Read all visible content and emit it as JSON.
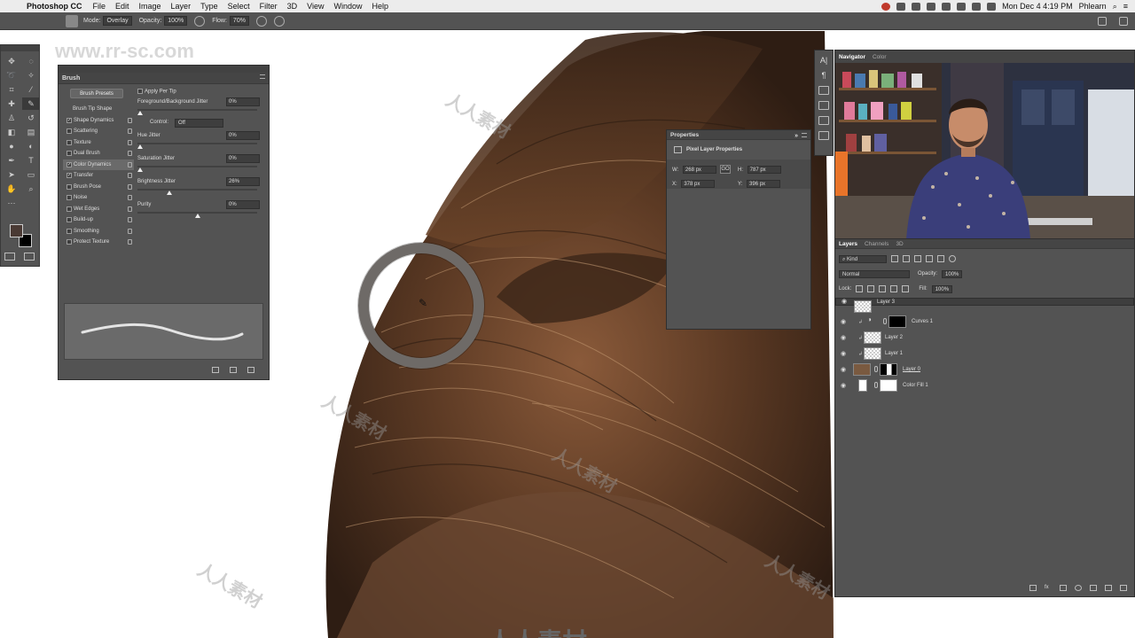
{
  "menubar": {
    "app_name": "Photoshop CC",
    "items": [
      "File",
      "Edit",
      "Image",
      "Layer",
      "Type",
      "Select",
      "Filter",
      "3D",
      "View",
      "Window",
      "Help"
    ],
    "clock": "Mon Dec 4  4:19 PM",
    "user": "Phlearn"
  },
  "options": {
    "mode_label": "Mode:",
    "mode_value": "Overlay",
    "opacity_label": "Opacity:",
    "opacity_value": "100%",
    "flow_label": "Flow:",
    "flow_value": "70%"
  },
  "watermark": {
    "url": "www.rr-sc.com",
    "text": "人人素材"
  },
  "brush_panel": {
    "title": "Brush",
    "presets_button": "Brush Presets",
    "tip_shape": "Brush Tip Shape",
    "items": [
      {
        "label": "Shape Dynamics",
        "checked": true
      },
      {
        "label": "Scattering",
        "checked": false
      },
      {
        "label": "Texture",
        "checked": false
      },
      {
        "label": "Dual Brush",
        "checked": false
      },
      {
        "label": "Color Dynamics",
        "checked": true
      },
      {
        "label": "Transfer",
        "checked": true
      },
      {
        "label": "Brush Pose",
        "checked": false
      },
      {
        "label": "Noise",
        "checked": false
      },
      {
        "label": "Wet Edges",
        "checked": false
      },
      {
        "label": "Build-up",
        "checked": false
      },
      {
        "label": "Smoothing",
        "checked": false
      },
      {
        "label": "Protect Texture",
        "checked": false
      }
    ],
    "apply_per_tip": "Apply Per Tip",
    "fg_bg_jitter_label": "Foreground/Background Jitter",
    "fg_bg_jitter_value": "0%",
    "control_label": "Control:",
    "control_value": "Off",
    "hue_jitter_label": "Hue Jitter",
    "hue_jitter_value": "0%",
    "saturation_jitter_label": "Saturation Jitter",
    "saturation_jitter_value": "0%",
    "brightness_jitter_label": "Brightness Jitter",
    "brightness_jitter_value": "26%",
    "purity_label": "Purity",
    "purity_value": "0%"
  },
  "properties": {
    "title": "Properties",
    "subtitle": "Pixel Layer Properties",
    "w_label": "W:",
    "w_value": "268 px",
    "h_label": "H:",
    "h_value": "787 px",
    "x_label": "X:",
    "x_value": "378 px",
    "y_label": "Y:",
    "y_value": "396 px",
    "link_glyph": "GO"
  },
  "navigator": {
    "tabs": [
      "Navigator",
      "Color"
    ]
  },
  "layers": {
    "tabs": [
      "Layers",
      "Channels",
      "3D"
    ],
    "kind_label": "Kind",
    "blend_mode": "Normal",
    "opacity_label": "Opacity:",
    "opacity_value": "100%",
    "lock_label": "Lock:",
    "fill_label": "Fill:",
    "fill_value": "100%",
    "rows": [
      {
        "name": "Layer 3",
        "selected": true
      },
      {
        "name": "Curves 1",
        "selected": false
      },
      {
        "name": "Layer 2",
        "selected": false
      },
      {
        "name": "Layer 1",
        "selected": false
      },
      {
        "name": "Layer 0",
        "selected": false
      },
      {
        "name": "Color Fill 1",
        "selected": false
      }
    ],
    "fx_label": "fx"
  }
}
